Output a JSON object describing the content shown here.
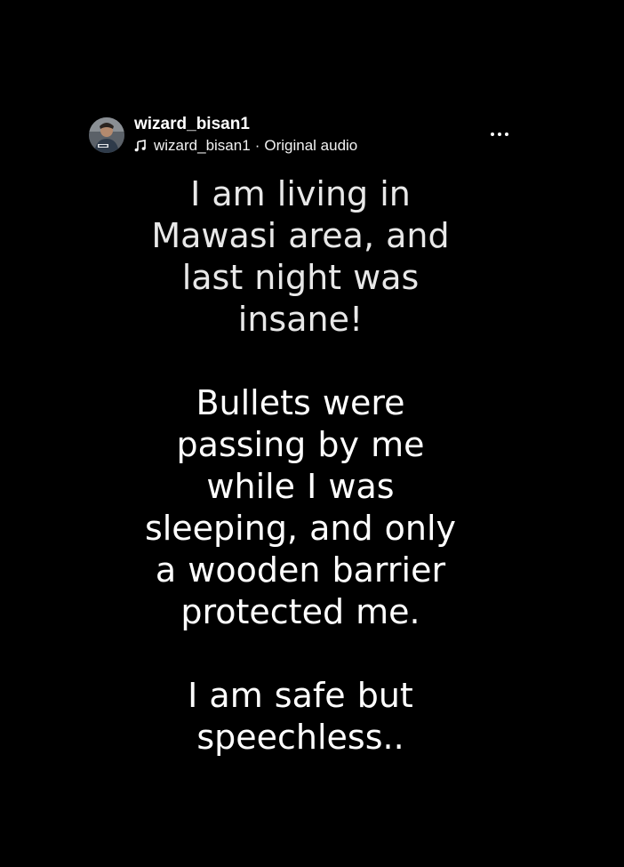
{
  "post": {
    "username": "wizard_bisan1",
    "audio": {
      "artist": "wizard_bisan1",
      "separator": "·",
      "title": "Original audio",
      "icon": "music-note-icon"
    },
    "more_icon": "more-horizontal-icon",
    "avatar_icon": "profile-photo",
    "text_color": "#ffffff",
    "background": "#000000"
  },
  "caption": {
    "paragraphs": [
      {
        "lines": [
          "I am living in",
          "Mawasi area, and",
          "last night was",
          "insane!"
        ]
      },
      {
        "lines": [
          "Bullets were",
          "passing by me",
          "while I was",
          "sleeping, and only",
          "a wooden barrier",
          "protected me."
        ]
      },
      {
        "lines": [
          "I am safe but",
          "speechless.."
        ]
      }
    ]
  }
}
